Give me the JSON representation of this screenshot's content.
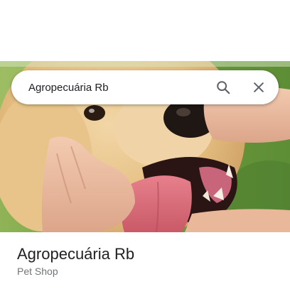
{
  "search": {
    "value": "Agropecuária Rb"
  },
  "place": {
    "title": "Agropecuária Rb",
    "category": "Pet Shop"
  },
  "icons": {
    "search": "search-icon",
    "close": "close-icon"
  },
  "colors": {
    "title": "#202124",
    "subtitle": "#70757a",
    "icon": "#5f6368"
  }
}
